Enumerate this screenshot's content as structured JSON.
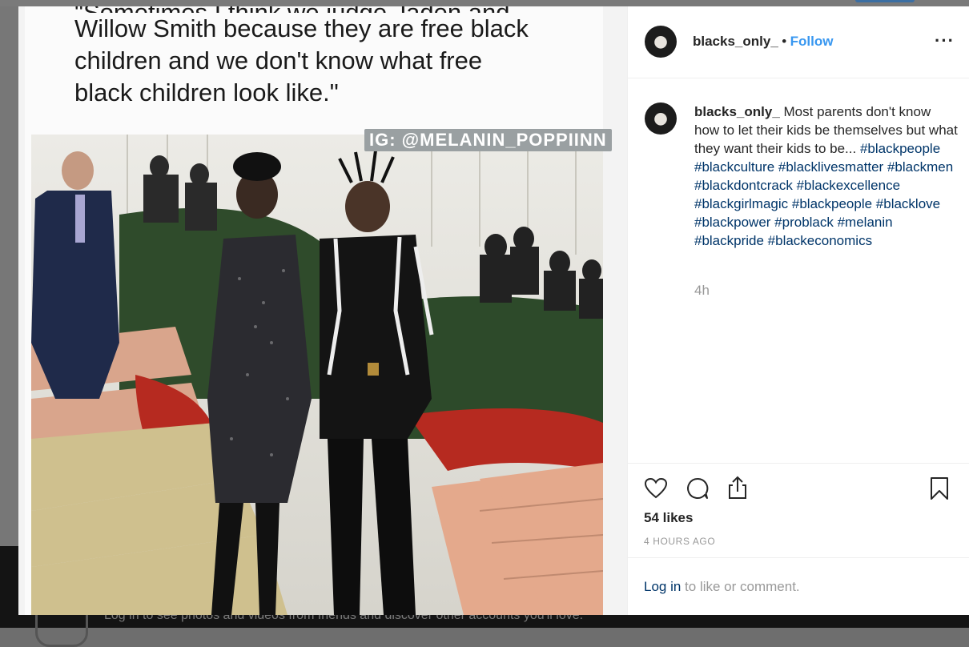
{
  "background": {
    "banner_text": "Log in to see photos and videos from friends and discover other accounts you'll love."
  },
  "post": {
    "image": {
      "quote_cut_line": "\"Sometimes I think we judge Jaden and",
      "quote_lines": [
        "Willow Smith because they are free black",
        "children and we don't know what free",
        "black children look like.\""
      ],
      "watermark": "IG: @MELANIN_POPPIINN"
    },
    "header": {
      "username": "blacks_only_",
      "separator": "•",
      "follow_label": "Follow",
      "more_label": "···"
    },
    "caption": {
      "username": "blacks_only_",
      "text": "Most parents don't know how to let their kids be themselves but what they want their kids to be...",
      "hashtags": "#blackpeople #blackculture #blacklivesmatter #blackmen #blackdontcrack #blackexcellence #blackgirlmagic #blackpeople #blacklove #blackpower #problack #melanin #blackpride #blackeconomics",
      "time_short": "4h"
    },
    "actions": {
      "likes": "54 likes",
      "posted_ago": "4 HOURS AGO"
    },
    "login": {
      "link": "Log in",
      "rest": " to like or comment."
    }
  },
  "colors": {
    "link_blue": "#3897f0",
    "hashtag_navy": "#003569",
    "muted_gray": "#999999"
  }
}
